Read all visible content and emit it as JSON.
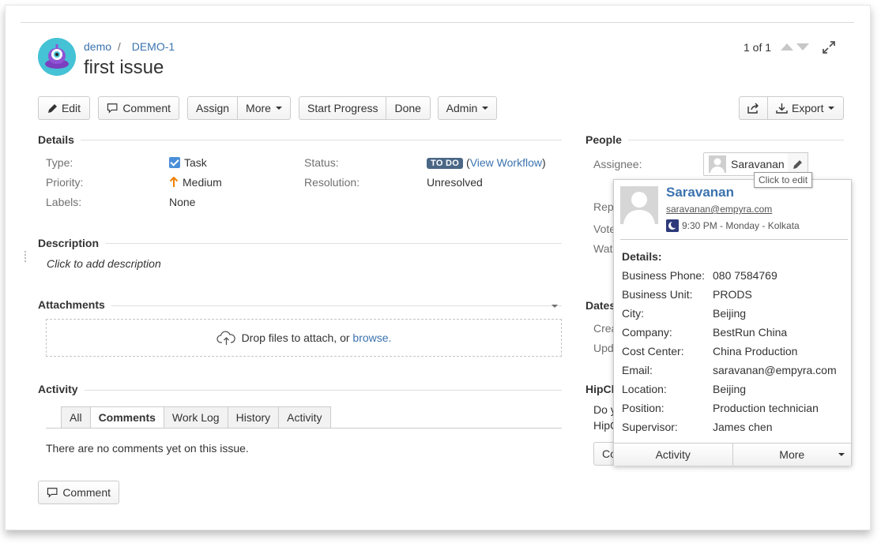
{
  "header": {
    "project": "demo",
    "separator": "/",
    "issue_key": "DEMO-1",
    "title": "first issue",
    "pager": "1 of 1"
  },
  "toolbar": {
    "edit": "Edit",
    "comment": "Comment",
    "assign": "Assign",
    "more": "More",
    "start_progress": "Start Progress",
    "done": "Done",
    "admin": "Admin",
    "export": "Export"
  },
  "details": {
    "heading": "Details",
    "type_label": "Type:",
    "type_value": "Task",
    "priority_label": "Priority:",
    "priority_value": "Medium",
    "labels_label": "Labels:",
    "labels_value": "None",
    "status_label": "Status:",
    "status_value": "TO DO",
    "view_workflow": "View Workflow",
    "resolution_label": "Resolution:",
    "resolution_value": "Unresolved"
  },
  "description": {
    "heading": "Description",
    "placeholder": "Click to add description"
  },
  "attachments": {
    "heading": "Attachments",
    "drop_text": "Drop files to attach, or",
    "browse": "browse."
  },
  "activity": {
    "heading": "Activity",
    "tabs": [
      "All",
      "Comments",
      "Work Log",
      "History",
      "Activity"
    ],
    "active_tab": "Comments",
    "empty_text": "There are no comments yet on this issue.",
    "comment_button": "Comment"
  },
  "people": {
    "heading": "People",
    "assignee_label": "Assignee:",
    "assignee_value": "Saravanan",
    "tooltip": "Click to edit",
    "reporter_partial": "Rep",
    "votes_partial": "Vote",
    "watchers_partial": "Wat"
  },
  "dates": {
    "heading_partial": "Dates",
    "created_partial": "Crea",
    "updated_partial": "Upd"
  },
  "hipchat": {
    "heading_partial": "HipCh",
    "line1_partial": "Do y",
    "line2_partial": "HipC",
    "button_partial": "Co"
  },
  "user_card": {
    "name": "Saravanan",
    "email": "saravanan@empyra.com",
    "time": "9:30 PM - Monday - Kolkata",
    "details_heading": "Details:",
    "rows": [
      {
        "label": "Business Phone:",
        "value": "080 7584769"
      },
      {
        "label": "Business Unit:",
        "value": "PRODS"
      },
      {
        "label": "City:",
        "value": "Beijing"
      },
      {
        "label": "Company:",
        "value": "BestRun China"
      },
      {
        "label": "Cost Center:",
        "value": "China Production"
      },
      {
        "label": "Email:",
        "value": "saravanan@empyra.com"
      },
      {
        "label": "Location:",
        "value": "Beijing"
      },
      {
        "label": "Position:",
        "value": "Production technician"
      },
      {
        "label": "Supervisor:",
        "value": "James chen"
      }
    ],
    "activity_button": "Activity",
    "more_button": "More"
  },
  "colors": {
    "link": "#3b73af",
    "status_lozenge": "#4a6785",
    "priority_medium": "#f07e00",
    "task_icon": "#4a90d9"
  }
}
